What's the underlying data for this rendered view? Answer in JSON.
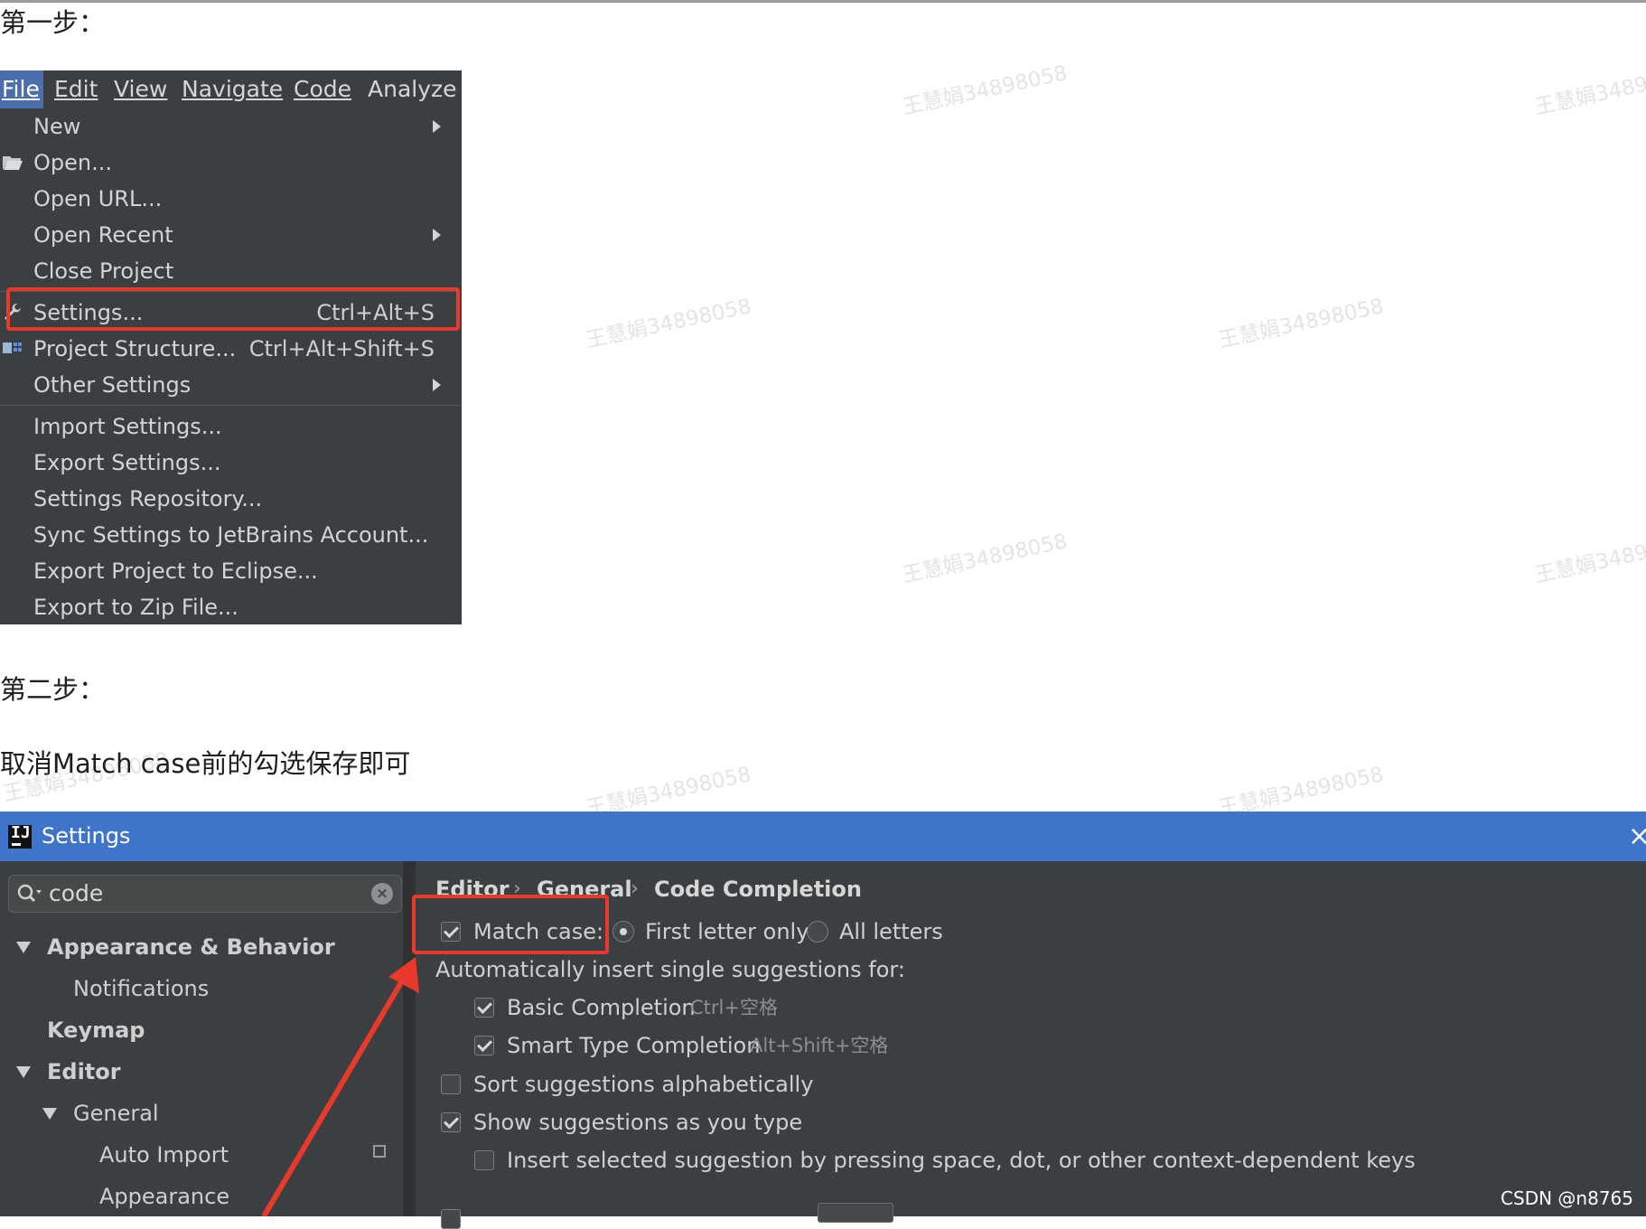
{
  "doc": {
    "step1": "第一步：",
    "step2": "第二步：",
    "instruction": "取消Match case前的勾选保存即可",
    "watermark": "王慧娟34898058",
    "credit": "CSDN @n8765"
  },
  "menubar": {
    "file": "File",
    "edit": "Edit",
    "view": "View",
    "navigate": "Navigate",
    "code": "Code",
    "analyze": "Analyze"
  },
  "file_menu": {
    "new": "New",
    "open": "Open...",
    "open_url": "Open URL...",
    "open_recent": "Open Recent",
    "close_project": "Close Project",
    "settings": "Settings...",
    "settings_shortcut": "Ctrl+Alt+S",
    "project_structure": "Project Structure...",
    "project_structure_shortcut": "Ctrl+Alt+Shift+S",
    "other_settings": "Other Settings",
    "import_settings": "Import Settings...",
    "export_settings": "Export Settings...",
    "settings_repository": "Settings Repository...",
    "sync_settings": "Sync Settings to JetBrains Account...",
    "export_eclipse": "Export Project to Eclipse...",
    "export_zip": "Export to Zip File..."
  },
  "settings_dialog": {
    "title": "Settings",
    "close": "×",
    "search_value": "code",
    "tree": {
      "appearance_behavior": "Appearance & Behavior",
      "notifications": "Notifications",
      "keymap": "Keymap",
      "editor": "Editor",
      "general": "General",
      "auto_import": "Auto Import",
      "appearance": "Appearance"
    },
    "breadcrumb": {
      "editor": "Editor",
      "general": "General",
      "code_completion": "Code Completion",
      "separator": "›"
    },
    "options": {
      "match_case": "Match case:",
      "match_case_checked": true,
      "first_letter_only": "First letter only",
      "all_letters": "All letters",
      "auto_insert_label": "Automatically insert single suggestions for:",
      "basic_completion": "Basic Completion",
      "basic_completion_shortcut": "Ctrl+空格",
      "smart_type_completion": "Smart Type Completion",
      "smart_type_shortcut": "Alt+Shift+空格",
      "sort_alphabetically": "Sort suggestions alphabetically",
      "show_as_you_type": "Show suggestions as you type",
      "insert_selected": "Insert selected suggestion by pressing space, dot, or other context-dependent keys"
    }
  },
  "colors": {
    "highlight_red": "#e8392a",
    "title_bar_blue": "#3e74c9",
    "menu_active_blue": "#4b6eaf",
    "ide_dark": "#3c3f41"
  }
}
